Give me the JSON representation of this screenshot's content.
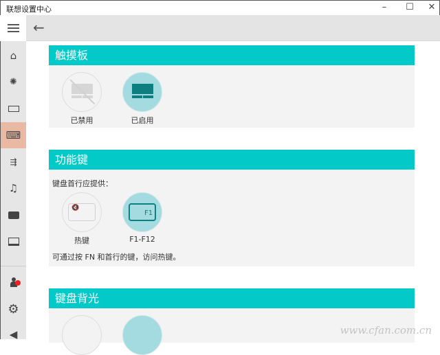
{
  "window": {
    "title": "联想设置中心",
    "minimize": "–",
    "maximize": "☐",
    "close": "✕"
  },
  "sidebar": {
    "items": [
      {
        "name": "home",
        "glyph": "⌂"
      },
      {
        "name": "lighting",
        "glyph": "💡"
      },
      {
        "name": "battery",
        "glyph": "▭"
      },
      {
        "name": "input",
        "glyph": "⌨"
      },
      {
        "name": "network",
        "glyph": "⇶"
      },
      {
        "name": "audio",
        "glyph": "♫"
      },
      {
        "name": "camera",
        "glyph": "◙"
      },
      {
        "name": "display",
        "glyph": "▭"
      }
    ],
    "bottom": [
      {
        "name": "account",
        "glyph": "●"
      },
      {
        "name": "settings",
        "glyph": "⚙"
      },
      {
        "name": "feedback",
        "glyph": "◀"
      }
    ]
  },
  "sections": {
    "touchpad": {
      "title": "触摸板",
      "options": [
        "已禁用",
        "已启用"
      ],
      "selected": 1
    },
    "fnkeys": {
      "title": "功能键",
      "prompt": "键盘首行应提供：",
      "options": [
        "热键",
        "F1-F12"
      ],
      "f1": "F1",
      "selected": 1,
      "note": "可通过按 FN 和首行的键，访问热键。"
    },
    "backlight": {
      "title": "键盘背光"
    }
  },
  "watermark": "www.cfan.com.cn"
}
